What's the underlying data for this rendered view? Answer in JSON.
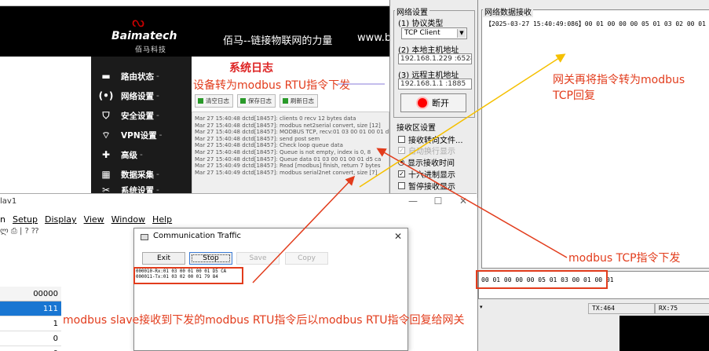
{
  "router": {
    "brand_name": "Baimatech",
    "brand_sub": "佰马科技",
    "slogan": "佰马--链接物联网的力量",
    "url": "www.b",
    "nav": [
      {
        "label": "路由状态",
        "icon": "dashboard-icon"
      },
      {
        "label": "网络设置",
        "icon": "network-icon"
      },
      {
        "label": "安全设置",
        "icon": "shield-icon"
      },
      {
        "label": "VPN设置",
        "icon": "wifi-icon"
      },
      {
        "label": "高级",
        "icon": "gear-icon"
      },
      {
        "label": "数据采集",
        "icon": "database-icon"
      },
      {
        "label": "系统设置",
        "icon": "tools-icon"
      }
    ],
    "caret": "-",
    "log_title": "系统日志",
    "buttons": {
      "clear": "清空日志",
      "save": "保存日志",
      "refresh": "刷新日志"
    },
    "log_lines": [
      "Mar 27 15:40:48 dctd[18457]: clients 0 recv 12 bytes data",
      "Mar 27 15:40:48 dctd[18457]: modbus net2serial convert, size [12]",
      "Mar 27 15:40:48 dctd[18457]: MODBUS TCP, recv:01 03 00 01 00 01 d5 c",
      "Mar 27 15:40:48 dctd[18457]: send post sem",
      "Mar 27 15:40:48 dctd[18457]: Check loop queue data",
      "Mar 27 15:40:48 dctd[18457]: Queue is not empty, index is 0, 8",
      "Mar 27 15:40:48 dctd[18457]: Queue data 01 03 00 01 00 01 d5 ca",
      "Mar 27 15:40:49 dctd[18457]: Read [modbus] finish, return 7 bytes",
      "Mar 27 15:40:49 dctd[18457]: modbus serial2net convert, size [7]"
    ]
  },
  "serial": {
    "net_settings_label": "网络设置",
    "protocol_label": "(1) 协议类型",
    "protocol_value": "TCP Client",
    "local_host_label": "(2) 本地主机地址",
    "local_host_value": "192.168.1.229 :65288",
    "remote_host_label": "(3) 远程主机地址",
    "remote_host_value": "192.168.1.1 :1885",
    "open_button": "断开",
    "recv_settings_label": "接收区设置",
    "options": [
      {
        "label": "接收转向文件...",
        "checked": false,
        "disabled": false,
        "type": "checkbox"
      },
      {
        "label": "自动换行显示",
        "checked": true,
        "disabled": true,
        "type": "checkbox"
      },
      {
        "label": "显示接收时间",
        "checked": true,
        "disabled": false,
        "type": "radio"
      },
      {
        "label": "十六进制显示",
        "checked": true,
        "disabled": false,
        "type": "checkbox"
      },
      {
        "label": "暂停接收显示",
        "checked": false,
        "disabled": false,
        "type": "checkbox"
      }
    ]
  },
  "net": {
    "recv_label": "网络数据接收",
    "recv_text": "【2025-03-27 15:40:49:086】00 01 00 00 00 05 01 03 02 00 01",
    "send_text": "00 01 00 00 00 05 01 03 00 01 00 01",
    "tx": "TX:464",
    "rx": "RX:75"
  },
  "modbus_slave": {
    "title": "lav1",
    "menu": [
      "n",
      "Setup",
      "Display",
      "View",
      "Window",
      "Help"
    ],
    "toolbar": "ლ ⎙ | ? ⁇",
    "grid": [
      "00000",
      "111",
      "1",
      "0",
      "0"
    ]
  },
  "traffic": {
    "title": "Communication Traffic",
    "buttons": {
      "exit": "Exit",
      "stop": "Stop",
      "save": "Save",
      "copy": "Copy"
    },
    "lines": [
      "000010-Rx:01 03 00 01 00 01 D5 CA",
      "000011-Tx:01 03 02 00 01 79 84"
    ]
  },
  "annotations": {
    "rtu_down": "设备转为modbus RTU指令下发",
    "tcp_reply": "网关再将指令转为modbus TCP回复",
    "tcp_down": "modbus TCP指令下发",
    "slave_reply": "modbus slave接收到下发的modbus RTU指令后以modbus RTU指令回复给网关",
    "color": "#e23c1c",
    "arrow_yellow": "#f5c000"
  }
}
